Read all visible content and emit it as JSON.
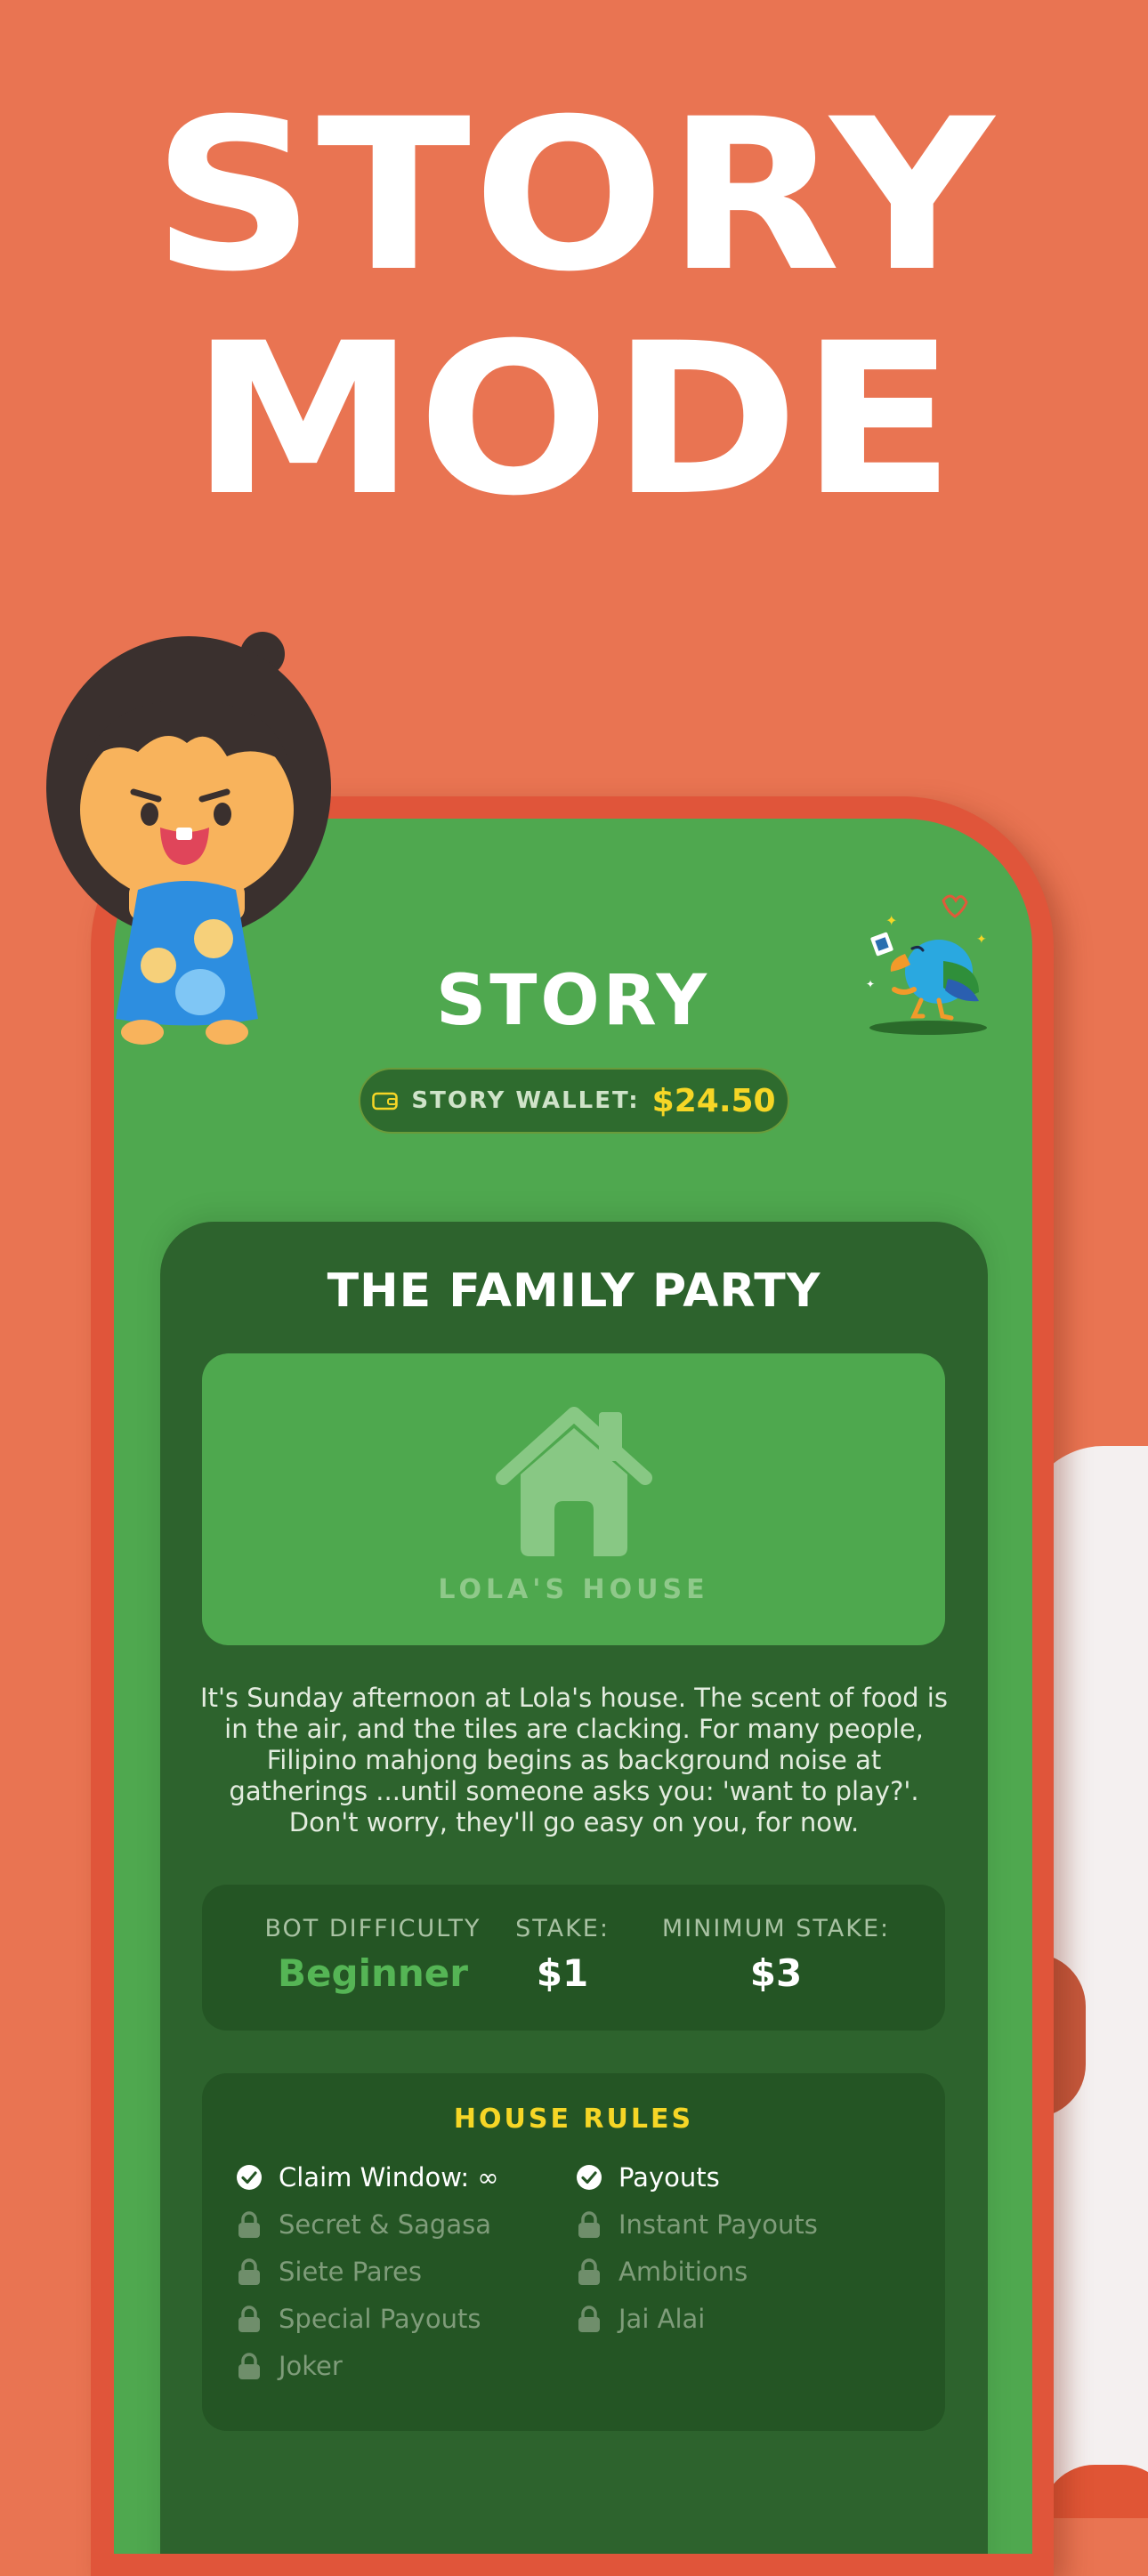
{
  "headline": {
    "line1": "STORY",
    "line2": "MODE"
  },
  "header": {
    "title": "STORY",
    "wallet_label": "STORY WALLET:",
    "wallet_amount": "$24.50"
  },
  "card": {
    "title": "THE FAMILY PARTY",
    "location_label": "LOLA'S HOUSE",
    "description": "It's Sunday afternoon at Lola's house. The scent of food is in the air, and the tiles are clacking. For many people, Filipino mahjong begins as background noise at gatherings ...until someone asks you: 'want to play?'. Don't worry, they'll go easy on you, for now."
  },
  "stats": [
    {
      "label": "BOT DIFFICULTY",
      "value": "Beginner"
    },
    {
      "label": "STAKE:",
      "value": "$1"
    },
    {
      "label": "MINIMUM STAKE:",
      "value": "$3"
    }
  ],
  "house_rules": {
    "title": "HOUSE RULES",
    "left": [
      {
        "label": "Claim Window: ∞",
        "state": "enabled"
      },
      {
        "label": "Secret & Sagasa",
        "state": "locked"
      },
      {
        "label": "Siete Pares",
        "state": "locked"
      },
      {
        "label": "Special Payouts",
        "state": "locked"
      },
      {
        "label": "Joker",
        "state": "locked"
      }
    ],
    "right": [
      {
        "label": "Payouts",
        "state": "enabled"
      },
      {
        "label": "Instant Payouts",
        "state": "locked"
      },
      {
        "label": "Ambitions",
        "state": "locked"
      },
      {
        "label": "Jai Alai",
        "state": "locked"
      }
    ]
  },
  "colors": {
    "background": "#e97452",
    "screen_green": "#4fa84f",
    "card_dark_green": "#2d632d",
    "accent_yellow": "#f6d626",
    "beginner_green": "#55b555"
  },
  "icons": [
    "wallet-icon",
    "house-icon",
    "check-circle-icon",
    "lock-icon",
    "girl-mascot",
    "parrot-mascot"
  ]
}
